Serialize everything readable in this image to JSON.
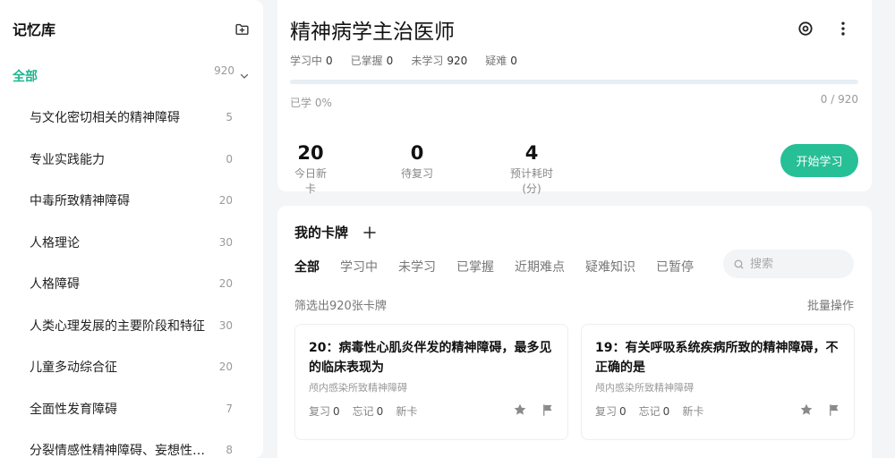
{
  "sidebar": {
    "title": "记忆库",
    "add_icon": "folder-add-icon",
    "all": {
      "label": "全部",
      "count": "920"
    },
    "items": [
      {
        "label": "与文化密切相关的精神障碍",
        "count": "5"
      },
      {
        "label": "专业实践能力",
        "count": "0"
      },
      {
        "label": "中毒所致精神障碍",
        "count": "20"
      },
      {
        "label": "人格理论",
        "count": "30"
      },
      {
        "label": "人格障碍",
        "count": "20"
      },
      {
        "label": "人类心理发展的主要阶段和特征",
        "count": "30"
      },
      {
        "label": "儿童多动综合征",
        "count": "20"
      },
      {
        "label": "全面性发育障碍",
        "count": "7"
      },
      {
        "label": "分裂情感性精神障碍、妄想性…",
        "count": "8"
      }
    ]
  },
  "deck": {
    "title": "精神病学主治医师",
    "stats": [
      {
        "label": "学习中",
        "value": "0"
      },
      {
        "label": "已掌握",
        "value": "0"
      },
      {
        "label": "未学习",
        "value": "920"
      },
      {
        "label": "疑难",
        "value": "0"
      }
    ],
    "progress_fraction": 0,
    "learned_label": "已学 0%",
    "ratio": "0 / 920",
    "metrics": [
      {
        "value": "20",
        "label": "今日新卡"
      },
      {
        "value": "0",
        "label": "待复习"
      },
      {
        "value": "4",
        "label": "预计耗时(分)"
      }
    ],
    "start_button": "开始学习"
  },
  "cards_panel": {
    "title": "我的卡牌",
    "tabs": [
      "全部",
      "学习中",
      "未学习",
      "已掌握",
      "近期难点",
      "疑难知识",
      "已暂停"
    ],
    "active_tab": "全部",
    "search_placeholder": "搜索",
    "filter_text": "筛选出920张卡牌",
    "batch_label": "批量操作",
    "cards": [
      {
        "question": "20：病毒性心肌炎伴发的精神障碍，最多见的临床表现为",
        "category": "颅内感染所致精神障碍",
        "review_label": "复习",
        "review_value": "0",
        "forget_label": "忘记",
        "forget_value": "0",
        "status": "新卡"
      },
      {
        "question": "19：有关呼吸系统疾病所致的精神障碍，不正确的是",
        "category": "颅内感染所致精神障碍",
        "review_label": "复习",
        "review_value": "0",
        "forget_label": "忘记",
        "forget_value": "0",
        "status": "新卡"
      }
    ]
  },
  "colors": {
    "accent": "#26bf96",
    "accent_text": "#1fb58f"
  }
}
